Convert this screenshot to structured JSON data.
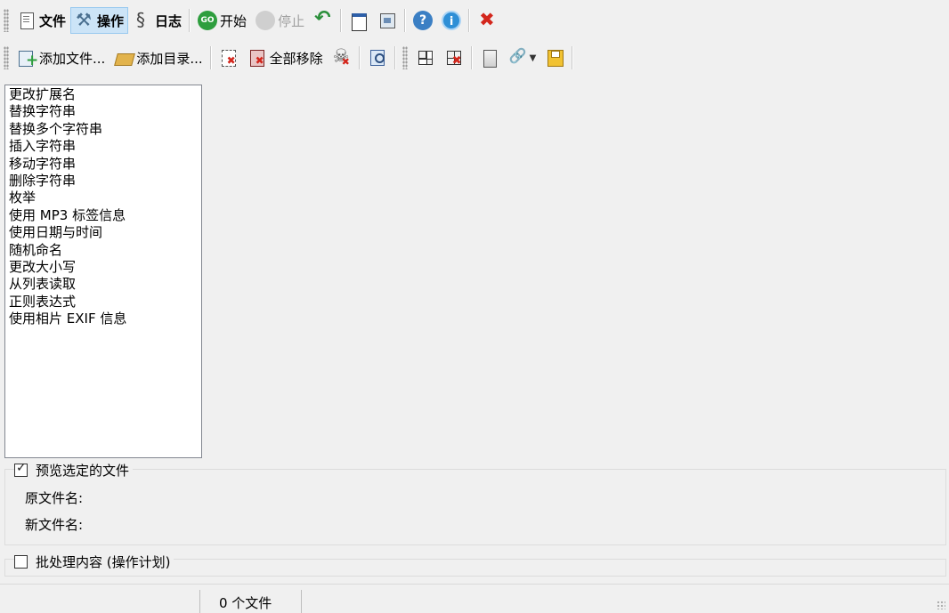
{
  "toolbar_top": {
    "file_label": "文件",
    "actions_label": "操作",
    "log_label": "日志",
    "start_label": "开始",
    "go_icon_text": "GO",
    "stop_label": "停止",
    "help_icon_text": "?",
    "info_icon_text": "i"
  },
  "toolbar_files": {
    "add_files_label": "添加文件...",
    "add_folder_label": "添加目录...",
    "remove_all_label": "全部移除"
  },
  "rename_actions": [
    "更改扩展名",
    "替换字符串",
    "替换多个字符串",
    "插入字符串",
    "移动字符串",
    "删除字符串",
    "枚举",
    "使用 MP3 标签信息",
    "使用日期与时间",
    "随机命名",
    "更改大小写",
    "从列表读取",
    "正则表达式",
    "使用相片 EXIF 信息"
  ],
  "preview": {
    "checkbox_label": "预览选定的文件",
    "checked": true,
    "original_name_label": "原文件名:",
    "new_name_label": "新文件名:"
  },
  "batch": {
    "checkbox_label": "批处理内容 (操作计划)",
    "checked": false
  },
  "status": {
    "file_count": "0 个文件"
  }
}
